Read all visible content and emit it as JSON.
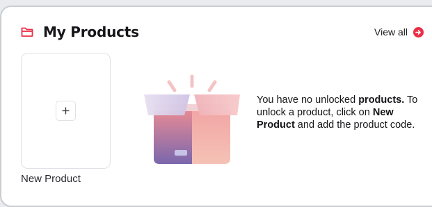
{
  "header": {
    "title": "My Products",
    "icon": "folder-icon",
    "view_all_label": "View all",
    "view_all_icon": "arrow-right-circle-icon"
  },
  "new_product_tile": {
    "icon": "plus-icon",
    "label": "New Product"
  },
  "empty_state": {
    "illustration": "open-box-illustration",
    "line1_prefix": "You have no unlocked ",
    "line1_bold": "products.",
    "line2": " To unlock a product, click on ",
    "line3_bold": "New Product",
    "line3_suffix": " and add the product code."
  },
  "colors": {
    "accent": "#ea2e48",
    "card_border": "#c9ccd1",
    "background": "#e9ebee"
  }
}
